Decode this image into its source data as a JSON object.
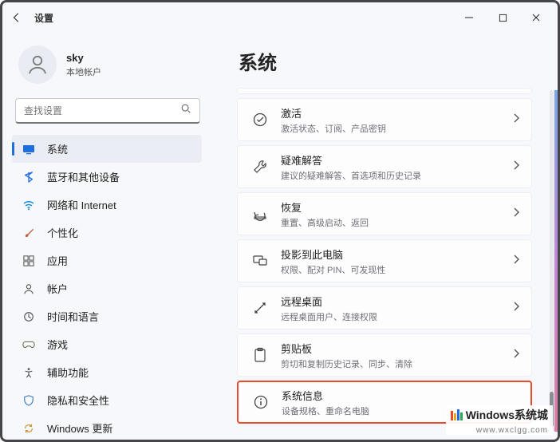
{
  "window": {
    "title": "设置"
  },
  "user": {
    "name": "sky",
    "account_type": "本地帐户"
  },
  "search": {
    "placeholder": "查找设置"
  },
  "nav": [
    {
      "id": "system",
      "label": "系统",
      "active": true
    },
    {
      "id": "bluetooth",
      "label": "蓝牙和其他设备",
      "active": false
    },
    {
      "id": "network",
      "label": "网络和 Internet",
      "active": false
    },
    {
      "id": "personalize",
      "label": "个性化",
      "active": false
    },
    {
      "id": "apps",
      "label": "应用",
      "active": false
    },
    {
      "id": "accounts",
      "label": "帐户",
      "active": false
    },
    {
      "id": "time",
      "label": "时间和语言",
      "active": false
    },
    {
      "id": "gaming",
      "label": "游戏",
      "active": false
    },
    {
      "id": "access",
      "label": "辅助功能",
      "active": false
    },
    {
      "id": "privacy",
      "label": "隐私和安全性",
      "active": false
    },
    {
      "id": "update",
      "label": "Windows 更新",
      "active": false
    }
  ],
  "page": {
    "title": "系统"
  },
  "cards": [
    {
      "id": "activation",
      "title": "激活",
      "sub": "激活状态、订阅、产品密钥"
    },
    {
      "id": "troubleshoot",
      "title": "疑难解答",
      "sub": "建议的疑难解答、首选项和历史记录"
    },
    {
      "id": "recovery",
      "title": "恢复",
      "sub": "重置、高级启动、返回"
    },
    {
      "id": "project",
      "title": "投影到此电脑",
      "sub": "权限、配对 PIN、可发现性"
    },
    {
      "id": "remote",
      "title": "远程桌面",
      "sub": "远程桌面用户、连接权限"
    },
    {
      "id": "clipboard",
      "title": "剪贴板",
      "sub": "剪切和复制历史记录、同步、清除"
    },
    {
      "id": "about",
      "title": "系统信息",
      "sub": "设备规格、重命名电脑"
    }
  ],
  "watermark": {
    "text": "Windows系统城",
    "url": "www.wxclgg.com"
  }
}
